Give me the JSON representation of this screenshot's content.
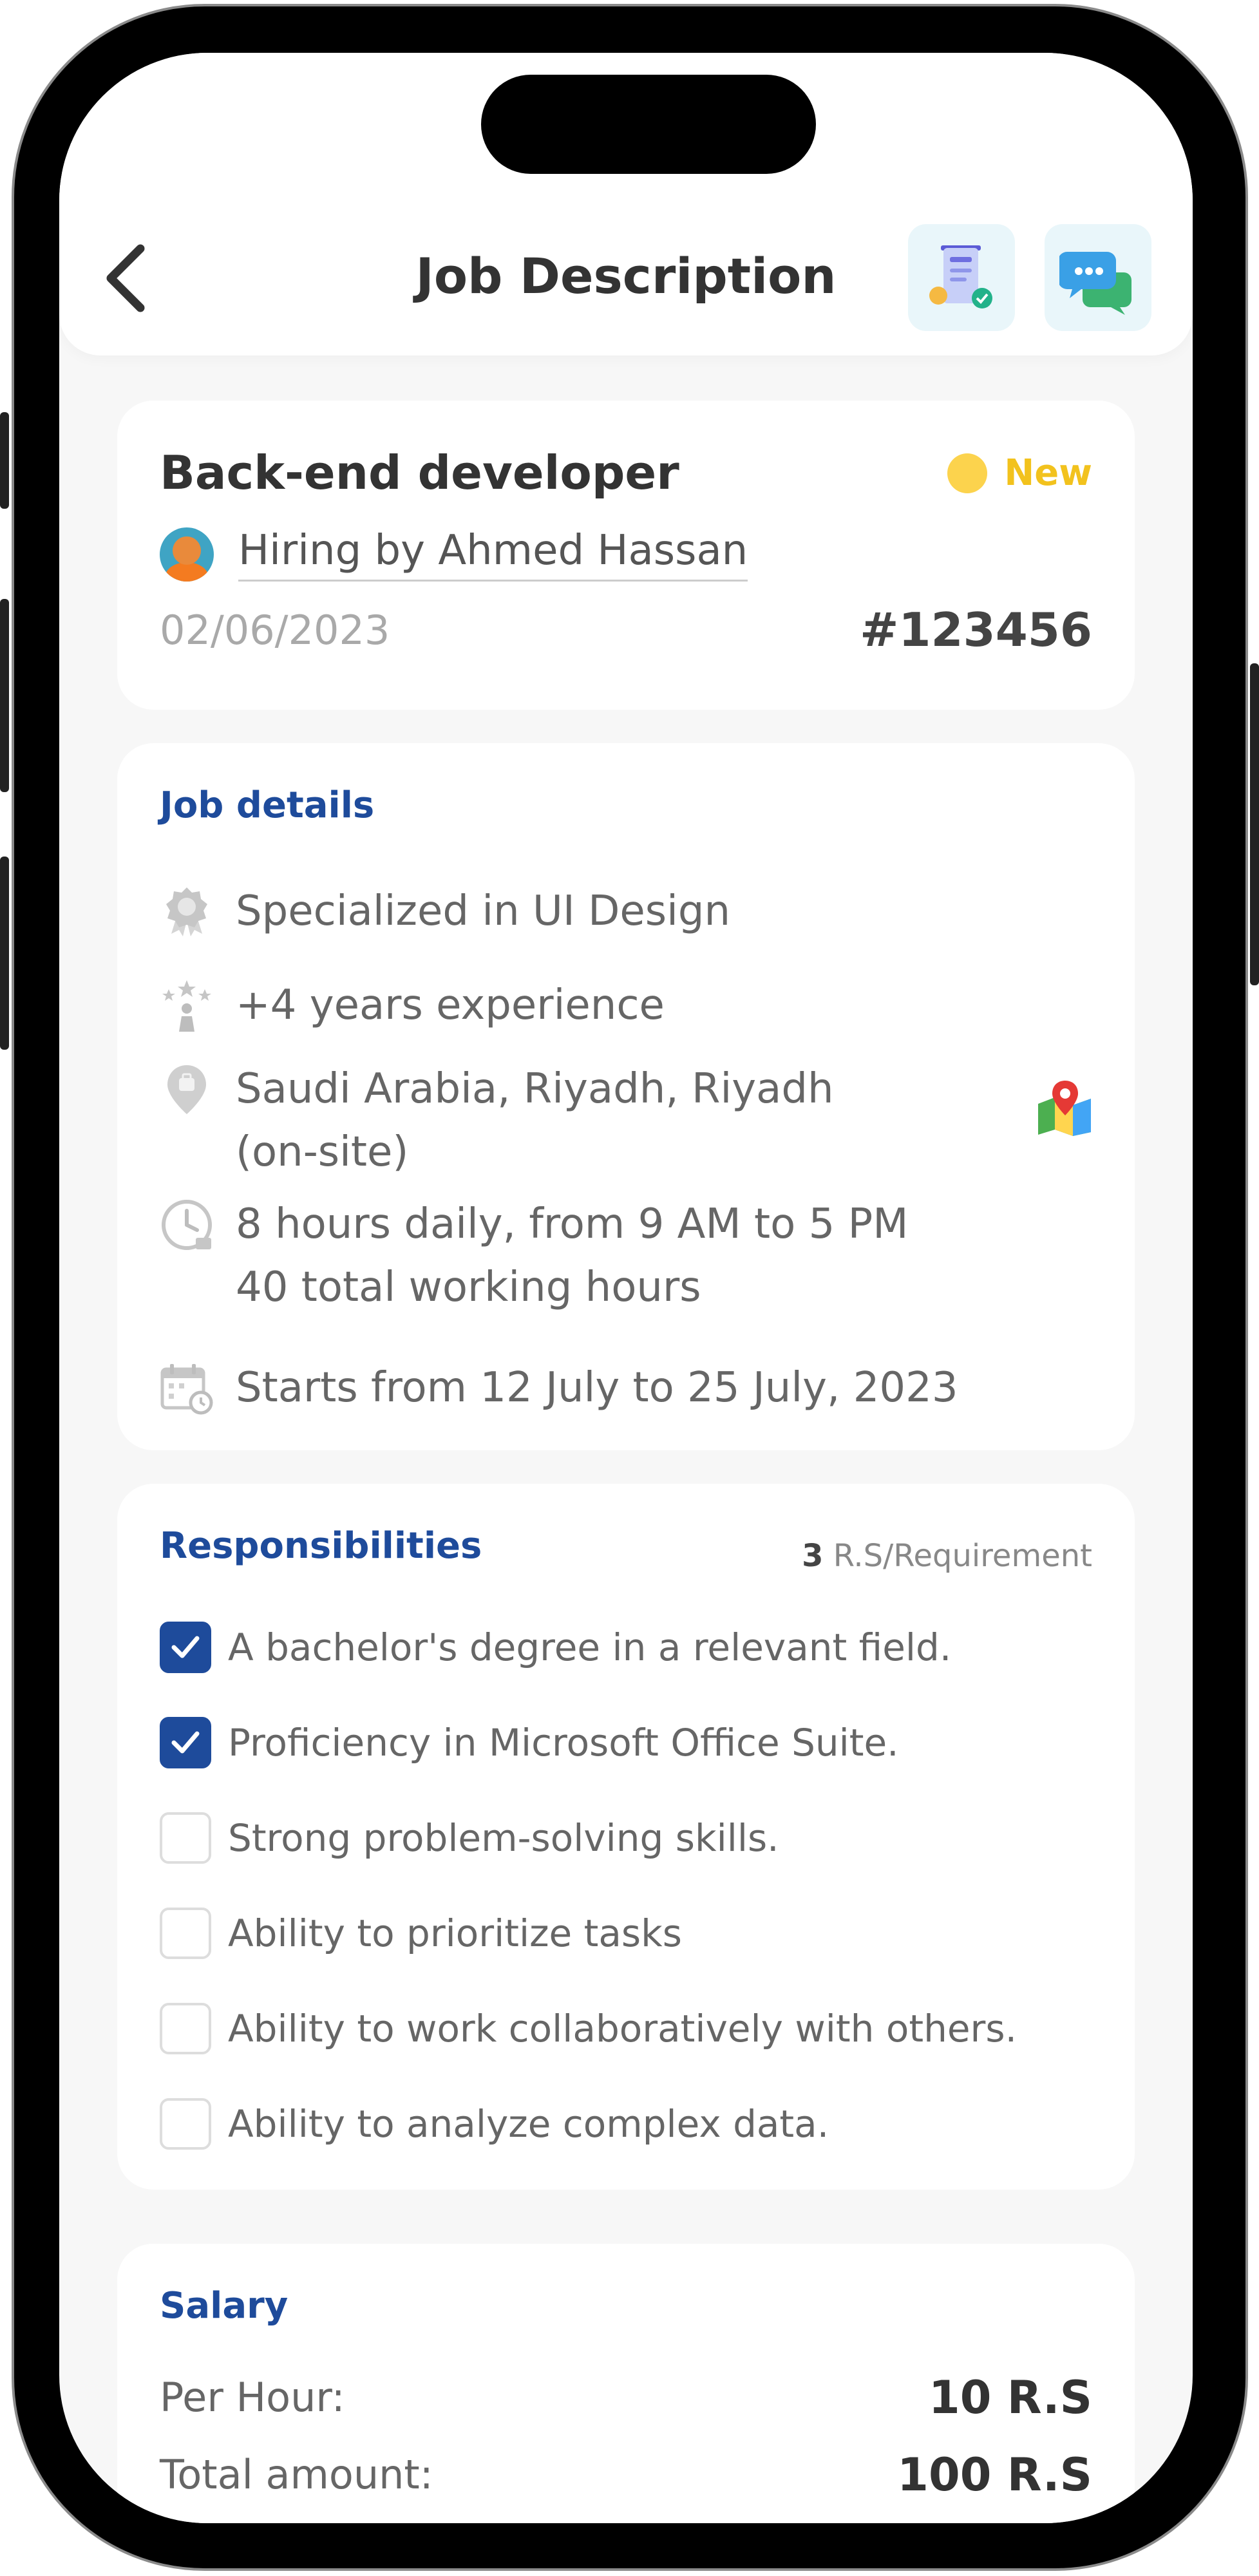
{
  "header": {
    "title": "Job Description",
    "back_icon": "chevron-left-icon",
    "icons": [
      "invoice-icon",
      "chat-bubble-icon"
    ]
  },
  "job": {
    "title": "Back-end developer",
    "status": "New",
    "hiring_by": "Hiring by Ahmed Hassan",
    "date": "02/06/2023",
    "id": "#123456"
  },
  "job_details": {
    "title": "Job details",
    "specialization": "Specialized in UI Design",
    "experience": "+4 years experience",
    "location_line1": "Saudi Arabia, Riyadh, Riyadh",
    "location_line2": "(on-site)",
    "hours_line1": "8 hours daily, from 9 AM to 5 PM",
    "hours_line2": "40 total working hours",
    "dates": "Starts from 12 July to 25 July, 2023"
  },
  "responsibilities": {
    "title": "Responsibilities",
    "count": "3",
    "count_suffix": " R.S/Requirement",
    "items": [
      {
        "text": "A bachelor's degree in a relevant field.",
        "checked": true
      },
      {
        "text": "Proficiency in Microsoft Office Suite.",
        "checked": true
      },
      {
        "text": "Strong problem-solving skills.",
        "checked": false
      },
      {
        "text": "Ability to prioritize tasks",
        "checked": false
      },
      {
        "text": "Ability to work collaboratively with others.",
        "checked": false
      },
      {
        "text": "Ability to analyze complex data.",
        "checked": false
      }
    ]
  },
  "salary": {
    "title": "Salary",
    "per_hour_label": "Per Hour:",
    "per_hour_value": "10 R.S",
    "total_label": "Total amount:",
    "total_value": "100 R.S"
  },
  "colors": {
    "accent": "#1e4b9b",
    "status": "#f2c21d"
  }
}
